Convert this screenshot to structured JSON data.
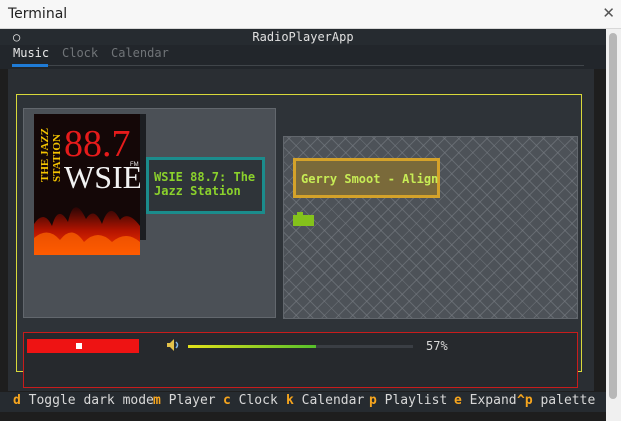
{
  "window": {
    "title": "Terminal",
    "close_icon": "close-icon"
  },
  "app": {
    "title": "RadioPlayerApp",
    "indicator": "○"
  },
  "tabs": [
    {
      "label": "Music",
      "active": true
    },
    {
      "label": "Clock",
      "active": false
    },
    {
      "label": "Calendar",
      "active": false
    }
  ],
  "station": {
    "logo": {
      "line1": "THE JAZZ",
      "line2": "STATION",
      "frequency": "88.7",
      "callsign": "WSIE",
      "band": "FM"
    },
    "name_line1": "WSIE 88.7: The",
    "name_line2": "Jazz Station"
  },
  "track": {
    "title": "Gerry Smoot - Align"
  },
  "player": {
    "progress_fraction": 0.46,
    "volume_percent": 57,
    "volume_label": "57%",
    "volume_icon": "speaker-icon"
  },
  "footer": [
    {
      "key": "d",
      "label": "Toggle dark mode"
    },
    {
      "key": "m",
      "label": "Player"
    },
    {
      "key": "c",
      "label": "Clock"
    },
    {
      "key": "k",
      "label": "Calendar"
    },
    {
      "key": "p",
      "label": "Playlist"
    },
    {
      "key": "e",
      "label": "Expand"
    },
    {
      "key": "^p",
      "label": "palette"
    }
  ],
  "colors": {
    "accent_tab": "#1f7bd6",
    "panel_border_yellow": "#d8d83a",
    "station_border": "#1b8c8c",
    "track_border": "#d4a22a",
    "player_border": "#c81c1c",
    "footer_key": "#f6a51e",
    "text_green": "#8bd12c"
  }
}
